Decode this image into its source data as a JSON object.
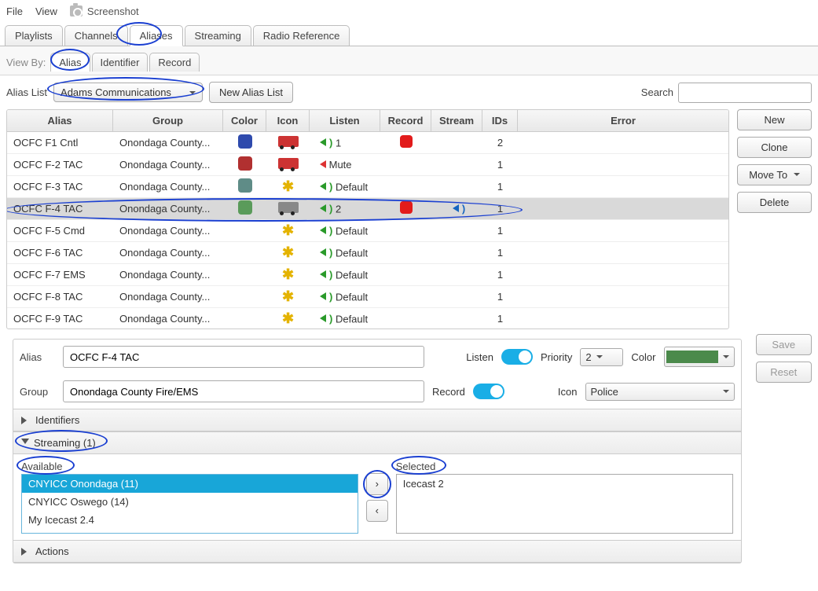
{
  "menu": {
    "file": "File",
    "view": "View",
    "screenshot": "Screenshot"
  },
  "tabs": {
    "playlists": "Playlists",
    "channels": "Channels",
    "aliases": "Aliases",
    "streaming": "Streaming",
    "radio_reference": "Radio Reference"
  },
  "viewby": {
    "label": "View By:",
    "alias": "Alias",
    "identifier": "Identifier",
    "record": "Record"
  },
  "filter": {
    "alias_list_label": "Alias List",
    "alias_list_value": "Adams Communications",
    "new_alias_list": "New Alias List",
    "search_label": "Search",
    "search_value": ""
  },
  "columns": {
    "alias": "Alias",
    "group": "Group",
    "color": "Color",
    "icon": "Icon",
    "listen": "Listen",
    "record": "Record",
    "stream": "Stream",
    "ids": "IDs",
    "error": "Error"
  },
  "rows": [
    {
      "alias": "OCFC F1 Cntl",
      "group": "Onondaga County...",
      "color": "#2e4aad",
      "icon": "truck-red",
      "listen": "1",
      "listen_style": "green",
      "record": true,
      "stream": false,
      "ids": "2"
    },
    {
      "alias": "OCFC F-2 TAC",
      "group": "Onondaga County...",
      "color": "#b13030",
      "icon": "truck-red",
      "listen": "Mute",
      "listen_style": "red",
      "record": false,
      "stream": false,
      "ids": "1"
    },
    {
      "alias": "OCFC F-3 TAC",
      "group": "Onondaga County...",
      "color": "#5f8c87",
      "icon": "asterisk",
      "listen": "Default",
      "listen_style": "green",
      "record": false,
      "stream": false,
      "ids": "1"
    },
    {
      "alias": "OCFC F-4 TAC",
      "group": "Onondaga County...",
      "color": "#5a9b5a",
      "icon": "truck-grey",
      "listen": "2",
      "listen_style": "green",
      "record": true,
      "stream": true,
      "ids": "1",
      "selected": true
    },
    {
      "alias": "OCFC F-5 Cmd",
      "group": "Onondaga County...",
      "color": "",
      "icon": "asterisk",
      "listen": "Default",
      "listen_style": "green",
      "record": false,
      "stream": false,
      "ids": "1"
    },
    {
      "alias": "OCFC F-6 TAC",
      "group": "Onondaga County...",
      "color": "",
      "icon": "asterisk",
      "listen": "Default",
      "listen_style": "green",
      "record": false,
      "stream": false,
      "ids": "1"
    },
    {
      "alias": "OCFC F-7 EMS",
      "group": "Onondaga County...",
      "color": "",
      "icon": "asterisk",
      "listen": "Default",
      "listen_style": "green",
      "record": false,
      "stream": false,
      "ids": "1"
    },
    {
      "alias": "OCFC F-8 TAC",
      "group": "Onondaga County...",
      "color": "",
      "icon": "asterisk",
      "listen": "Default",
      "listen_style": "green",
      "record": false,
      "stream": false,
      "ids": "1"
    },
    {
      "alias": "OCFC F-9 TAC",
      "group": "Onondaga County...",
      "color": "",
      "icon": "asterisk",
      "listen": "Default",
      "listen_style": "green",
      "record": false,
      "stream": false,
      "ids": "1"
    }
  ],
  "sidebar_buttons": {
    "new": "New",
    "clone": "Clone",
    "move_to": "Move To",
    "delete": "Delete"
  },
  "detail": {
    "alias_label": "Alias",
    "alias_value": "OCFC F-4 TAC",
    "group_label": "Group",
    "group_value": "Onondaga County Fire/EMS",
    "listen_label": "Listen",
    "record_label": "Record",
    "priority_label": "Priority",
    "priority_value": "2",
    "color_label": "Color",
    "icon_label": "Icon",
    "icon_value": "Police",
    "save": "Save",
    "reset": "Reset"
  },
  "accordions": {
    "identifiers": "Identifiers",
    "streaming": "Streaming (1)",
    "actions": "Actions"
  },
  "streaming": {
    "available_label": "Available",
    "selected_label": "Selected",
    "available": [
      "CNYICC Onondaga (11)",
      "CNYICC Oswego (14)",
      "My Icecast 2.4"
    ],
    "selected": [
      "Icecast 2"
    ]
  }
}
